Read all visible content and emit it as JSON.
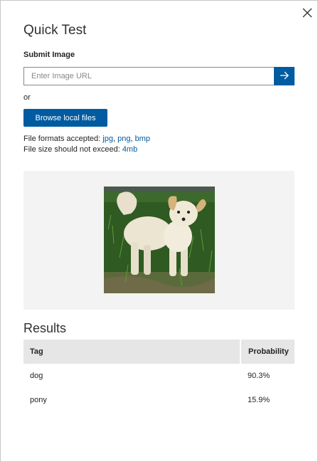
{
  "dialog": {
    "title": "Quick Test",
    "close_icon": "close-icon"
  },
  "submit": {
    "label": "Submit Image",
    "url_placeholder": "Enter Image URL",
    "url_value": "",
    "go_icon": "arrow-right-icon",
    "or_text": "or",
    "browse_label": "Browse local files"
  },
  "info": {
    "formats_prefix": "File formats accepted: ",
    "formats": [
      "jpg",
      "png",
      "bmp"
    ],
    "size_prefix": "File size should not exceed: ",
    "size_limit": "4mb"
  },
  "preview": {
    "image_icon": "dog-photo"
  },
  "results": {
    "title": "Results",
    "columns": [
      "Tag",
      "Probability"
    ],
    "rows": [
      {
        "tag": "dog",
        "probability": "90.3%"
      },
      {
        "tag": "pony",
        "probability": "15.9%"
      }
    ]
  },
  "colors": {
    "accent": "#005ba1",
    "header_bg": "#e6e6e6",
    "preview_bg": "#f3f3f3"
  }
}
